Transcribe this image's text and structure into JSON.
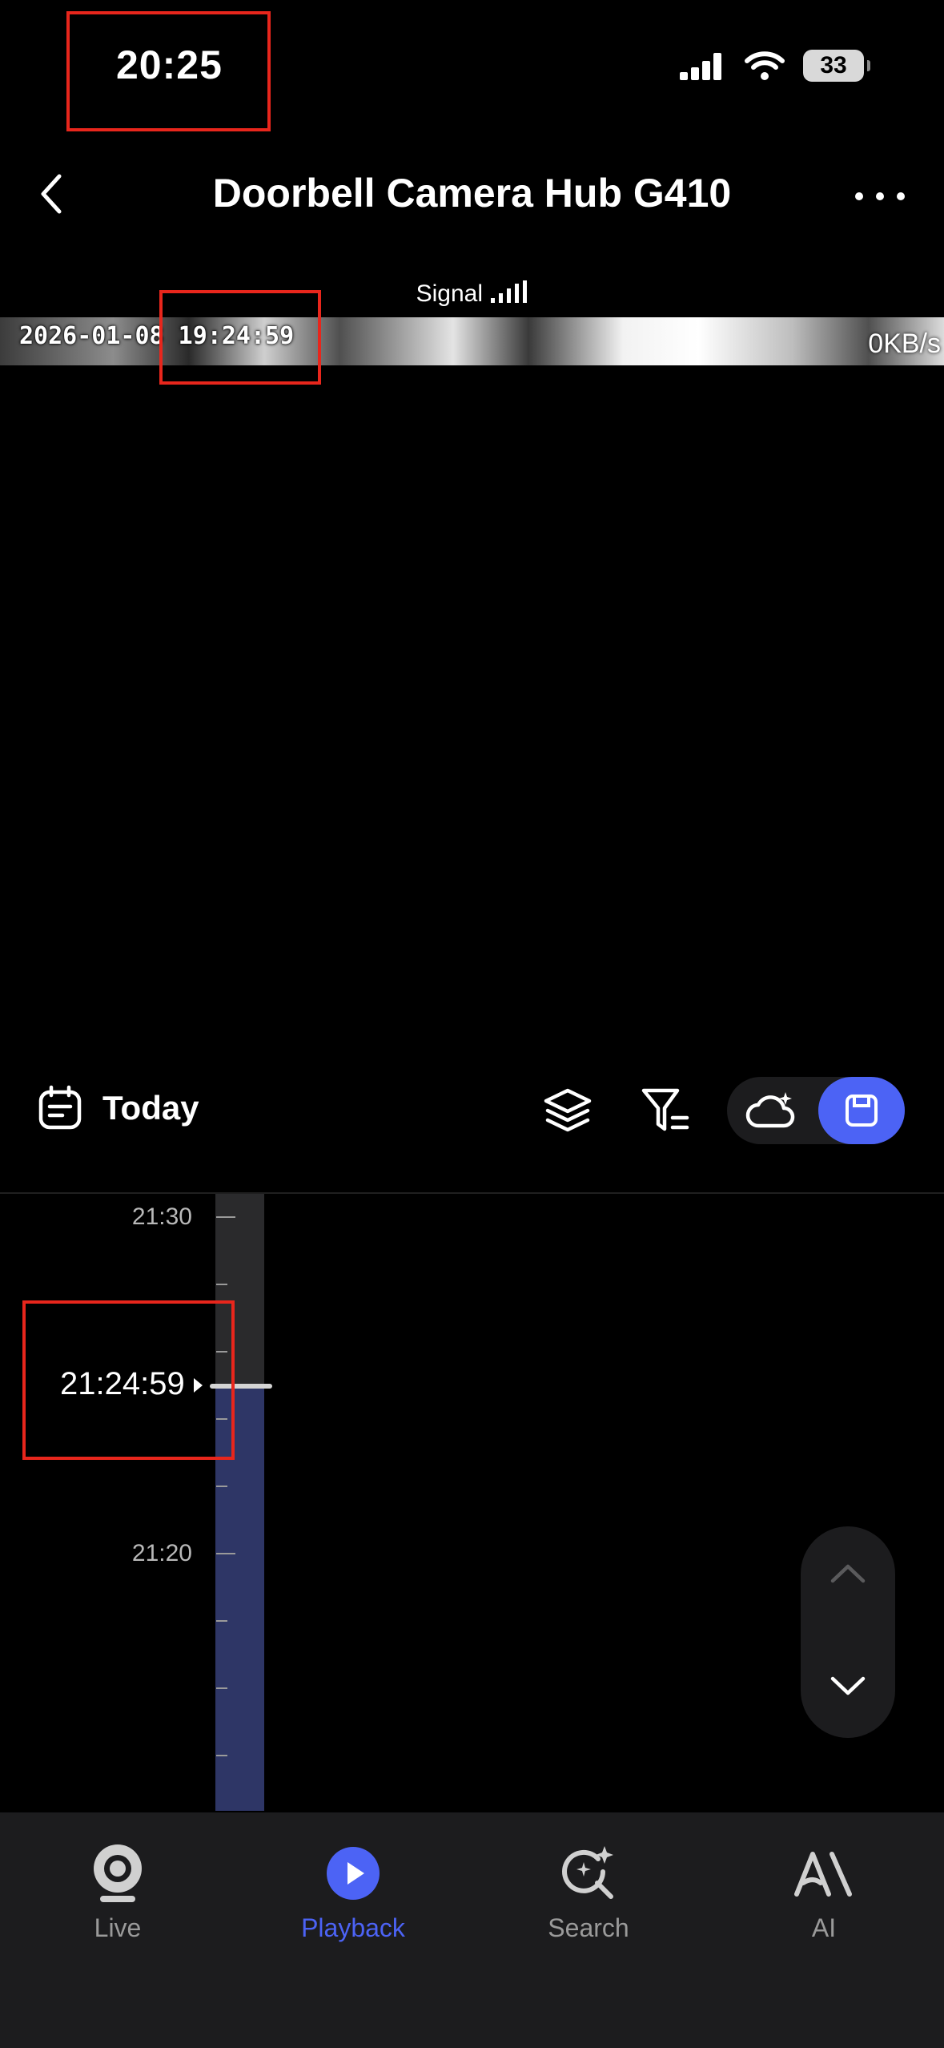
{
  "status_bar": {
    "time": "20:25",
    "battery": "33"
  },
  "header": {
    "title": "Doorbell Camera Hub G410"
  },
  "video": {
    "signal_label": "Signal",
    "timestamp": "2026-01-08 19:24:59",
    "speed": "0KB/s"
  },
  "toolbar": {
    "date_label": "Today"
  },
  "timeline": {
    "labels": [
      "21:30",
      "21:20"
    ],
    "current_time": "21:24:59"
  },
  "bottom_nav": {
    "items": [
      {
        "label": "Live",
        "icon": "camera-icon"
      },
      {
        "label": "Playback",
        "icon": "play-icon",
        "active": true
      },
      {
        "label": "Search",
        "icon": "ai-search-icon"
      },
      {
        "label": "AI",
        "icon": "ai-logo-icon"
      }
    ]
  },
  "colors": {
    "accent": "#4c63f5",
    "highlight": "#e8261c",
    "recorded": "#2e3666"
  }
}
